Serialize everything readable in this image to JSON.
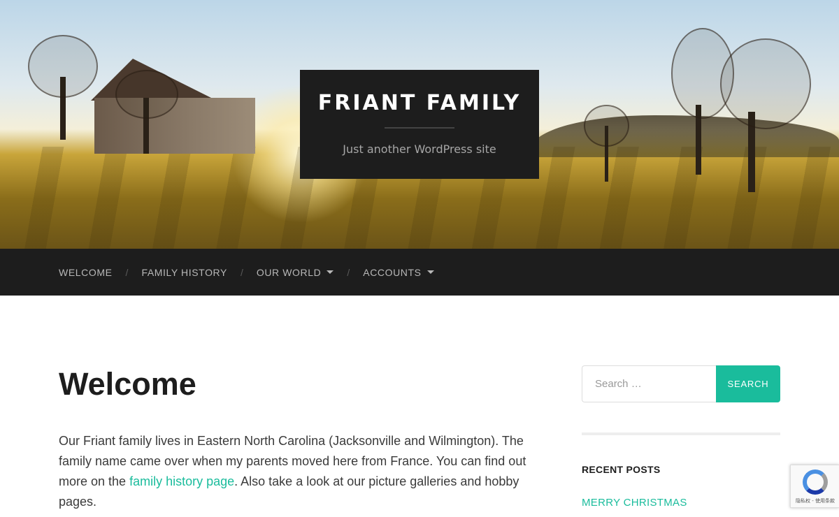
{
  "site": {
    "title": "FRIANT FAMILY",
    "tagline": "Just another WordPress site"
  },
  "nav": {
    "items": [
      {
        "label": "WELCOME",
        "has_dropdown": false
      },
      {
        "label": "FAMILY HISTORY",
        "has_dropdown": false
      },
      {
        "label": "OUR WORLD",
        "has_dropdown": true
      },
      {
        "label": "ACCOUNTS",
        "has_dropdown": true
      }
    ],
    "separator": "/"
  },
  "post": {
    "title": "Welcome",
    "body_before_link": "Our Friant family lives in Eastern North Carolina (Jacksonville and Wilmington). The family name came over when my parents moved here from France. You can find out more on the ",
    "link_text": "family history page",
    "body_after_link": ". Also take a look at our picture galleries and hobby pages."
  },
  "sidebar": {
    "search": {
      "placeholder": "Search …",
      "button_label": "SEARCH"
    },
    "recent_posts": {
      "title": "RECENT POSTS",
      "items": [
        {
          "label": "MERRY CHRISTMAS"
        }
      ]
    }
  },
  "recaptcha": {
    "footer_text": "隐私权 - 使用条款"
  },
  "colors": {
    "accent": "#1abc9c",
    "dark_bar": "#1d1d1d",
    "nav_text": "#b8b8b8"
  },
  "icons": {
    "dropdown": "caret-down-icon",
    "recaptcha": "recaptcha-icon"
  }
}
